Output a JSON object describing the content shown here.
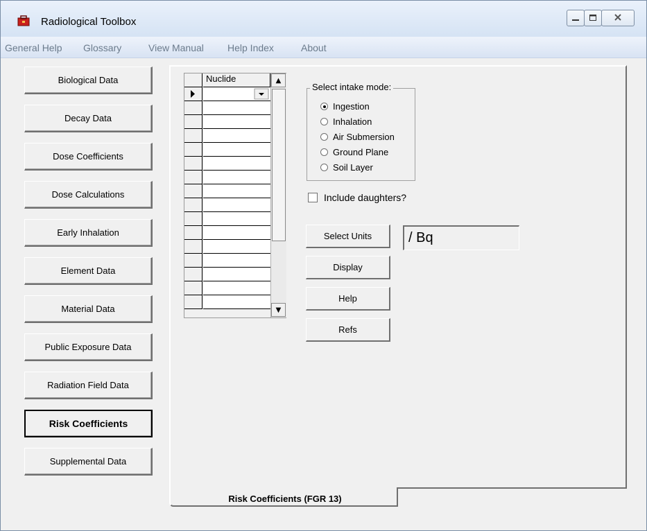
{
  "window": {
    "title": "Radiological Toolbox",
    "app_icon": "toolbox-icon"
  },
  "menu": [
    "General Help",
    "Glossary",
    "View Manual",
    "Help Index",
    "About"
  ],
  "nav_buttons": [
    "Biological Data",
    "Decay Data",
    "Dose Coefficients",
    "Dose Calculations",
    "Early Inhalation",
    "Element Data",
    "Material Data",
    "Public Exposure Data",
    "Radiation Field Data",
    "Risk Coefficients",
    "Supplemental Data"
  ],
  "active_nav": "Risk Coefficients",
  "grid": {
    "header": "Nuclide",
    "current_row_indicator": "row-pointer-icon"
  },
  "intake": {
    "title": "Select intake mode:",
    "options": [
      "Ingestion",
      "Inhalation",
      "Air Submersion",
      "Ground Plane",
      "Soil Layer"
    ],
    "selected": "Ingestion"
  },
  "include_daughters": {
    "label": "Include daughters?",
    "checked": false
  },
  "buttons": {
    "select_units": "Select Units",
    "display": "Display",
    "help": "Help",
    "refs": "Refs"
  },
  "units_value": "/ Bq",
  "tab_label": "Risk Coefficients (FGR 13)",
  "colors": {
    "menu_text": "#6b7b8c",
    "titlebar": "#dce7f5",
    "face": "#f0f0f0"
  }
}
